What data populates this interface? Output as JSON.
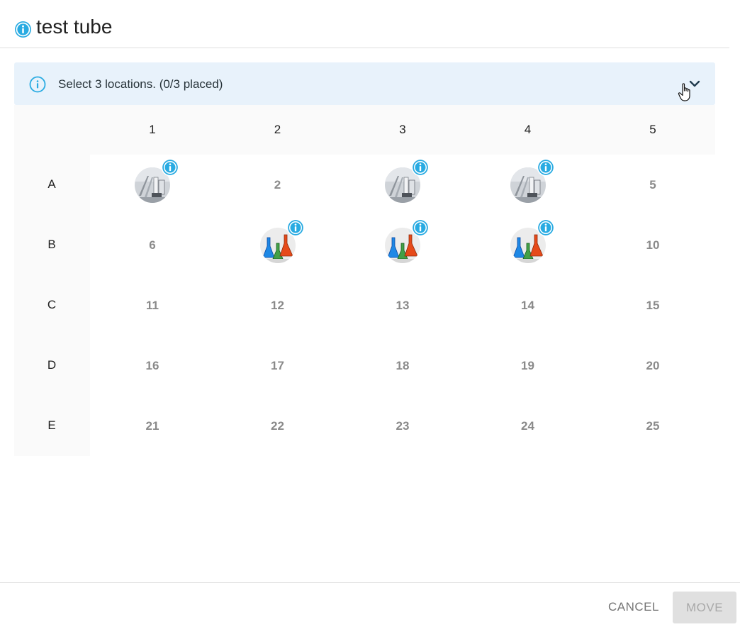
{
  "dialog": {
    "title": "test tube",
    "title_icon": "info-icon"
  },
  "banner": {
    "message": "Select 3 locations. (0/3 placed)",
    "icon": "info-icon",
    "toggle_icon": "chevron-down-icon"
  },
  "grid": {
    "columns": [
      "1",
      "2",
      "3",
      "4",
      "5"
    ],
    "rows": [
      {
        "label": "A",
        "cells": [
          {
            "type": "item",
            "image": "lab-glassware-photo"
          },
          {
            "type": "empty",
            "number": "2"
          },
          {
            "type": "item",
            "image": "lab-glassware-photo"
          },
          {
            "type": "item",
            "image": "lab-glassware-photo"
          },
          {
            "type": "empty",
            "number": "5"
          }
        ]
      },
      {
        "label": "B",
        "cells": [
          {
            "type": "empty",
            "number": "6"
          },
          {
            "type": "item",
            "image": "colored-flasks"
          },
          {
            "type": "item",
            "image": "colored-flasks"
          },
          {
            "type": "item",
            "image": "colored-flasks"
          },
          {
            "type": "empty",
            "number": "10"
          }
        ]
      },
      {
        "label": "C",
        "cells": [
          {
            "type": "empty",
            "number": "11"
          },
          {
            "type": "empty",
            "number": "12"
          },
          {
            "type": "empty",
            "number": "13"
          },
          {
            "type": "empty",
            "number": "14"
          },
          {
            "type": "empty",
            "number": "15"
          }
        ]
      },
      {
        "label": "D",
        "cells": [
          {
            "type": "empty",
            "number": "16"
          },
          {
            "type": "empty",
            "number": "17"
          },
          {
            "type": "empty",
            "number": "18"
          },
          {
            "type": "empty",
            "number": "19"
          },
          {
            "type": "empty",
            "number": "20"
          }
        ]
      },
      {
        "label": "E",
        "cells": [
          {
            "type": "empty",
            "number": "21"
          },
          {
            "type": "empty",
            "number": "22"
          },
          {
            "type": "empty",
            "number": "23"
          },
          {
            "type": "empty",
            "number": "24"
          },
          {
            "type": "empty",
            "number": "25"
          }
        ]
      }
    ]
  },
  "footer": {
    "cancel_label": "CANCEL",
    "move_label": "MOVE",
    "move_enabled": false
  },
  "colors": {
    "accent": "#29abe2",
    "banner_bg": "#e8f2fb",
    "header_bg": "#fafafa"
  }
}
